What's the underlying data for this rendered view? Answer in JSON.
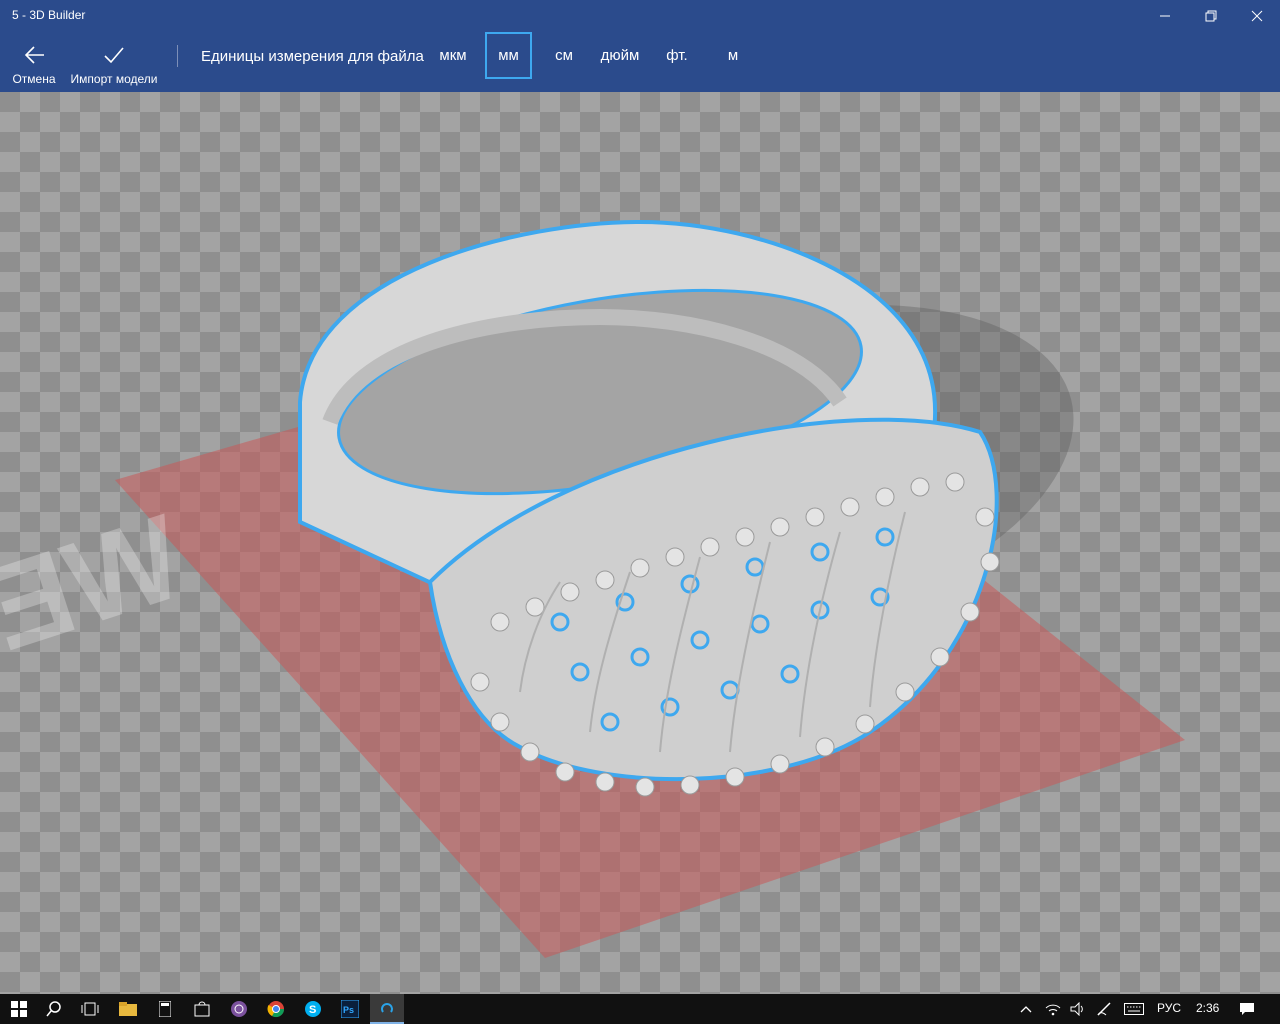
{
  "window": {
    "title": "5 - 3D Builder"
  },
  "toolbar": {
    "cancel_label": "Отмена",
    "import_label": "Импорт модели",
    "units_label": "Единицы измерения для файла",
    "units": [
      "мкм",
      "мм",
      "см",
      "дюйм",
      "фт.",
      "м"
    ],
    "selected_unit": "мм"
  },
  "viewport": {
    "model": "ring",
    "highlight_color": "#3ea8ef",
    "plate_color": "#c85a5a",
    "watermark": "WEO"
  },
  "taskbar": {
    "language": "РУС",
    "time": "2:36"
  },
  "colors": {
    "accent": "#2b4b8c",
    "selection": "#3ea8ef"
  }
}
